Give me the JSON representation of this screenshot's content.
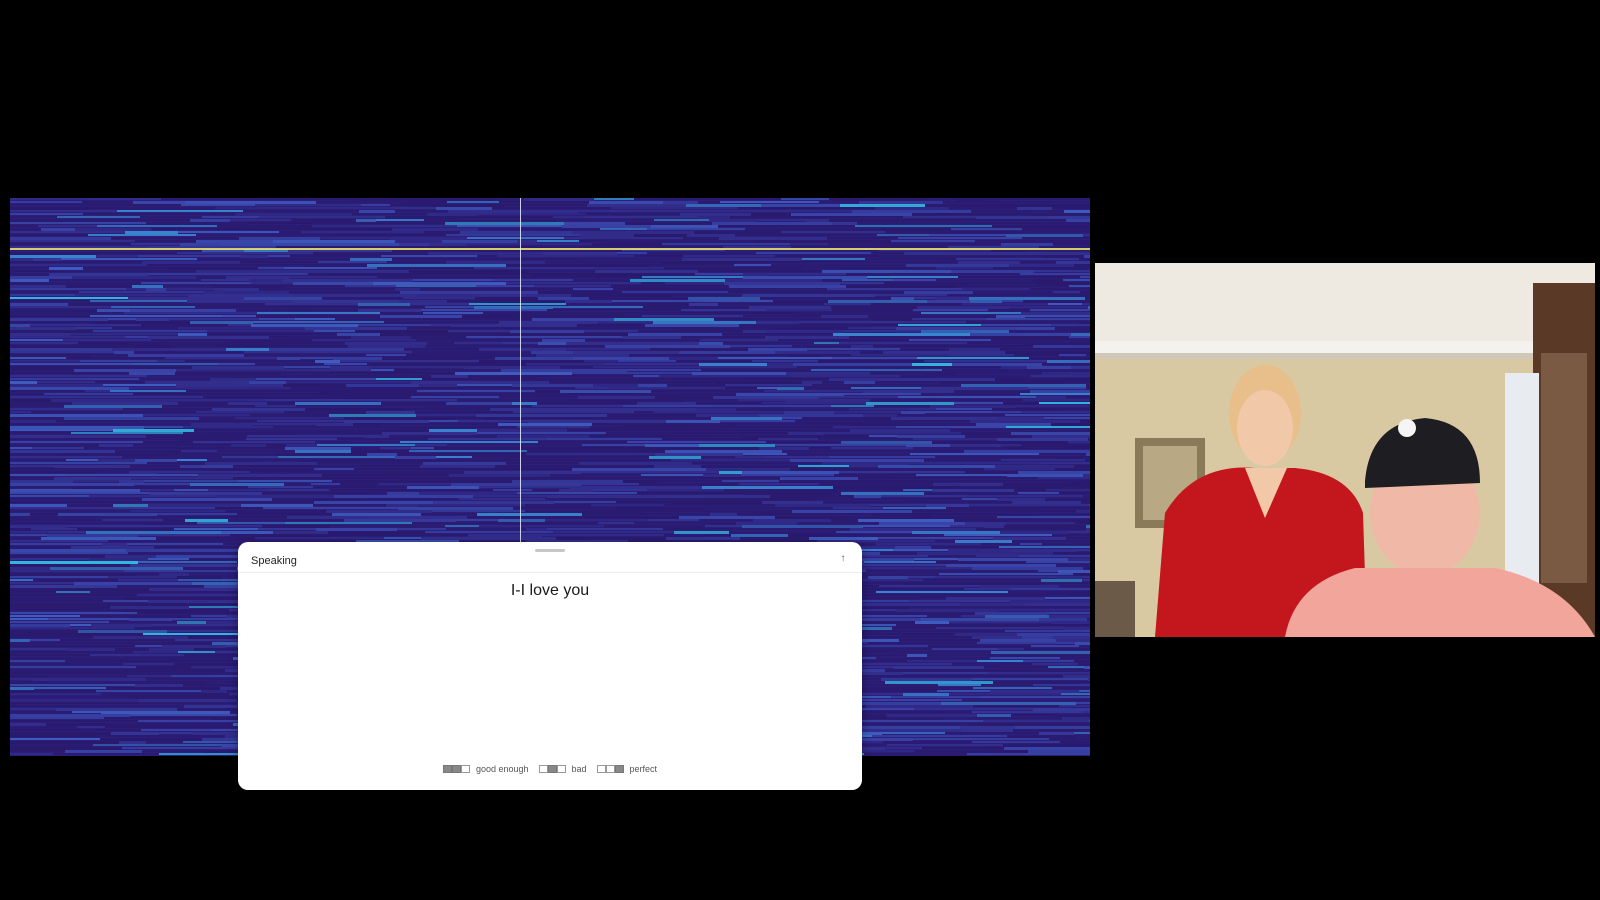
{
  "panel": {
    "title": "Speaking",
    "transcript": "I-I love you",
    "collapse_icon": "arrow-up-icon",
    "legend": [
      {
        "label": "good enough",
        "pattern": [
          true,
          true,
          false
        ]
      },
      {
        "label": "bad",
        "pattern": [
          false,
          true,
          false
        ]
      },
      {
        "label": "perfect",
        "pattern": [
          false,
          false,
          true
        ]
      }
    ]
  },
  "spectrogram": {
    "colors": {
      "base": "#2b1f7a",
      "mid": "#3f4fb8",
      "high": "#33b8e0",
      "marker": "#e8e06a"
    }
  },
  "video": {
    "description_icon": "webcam-feed"
  }
}
